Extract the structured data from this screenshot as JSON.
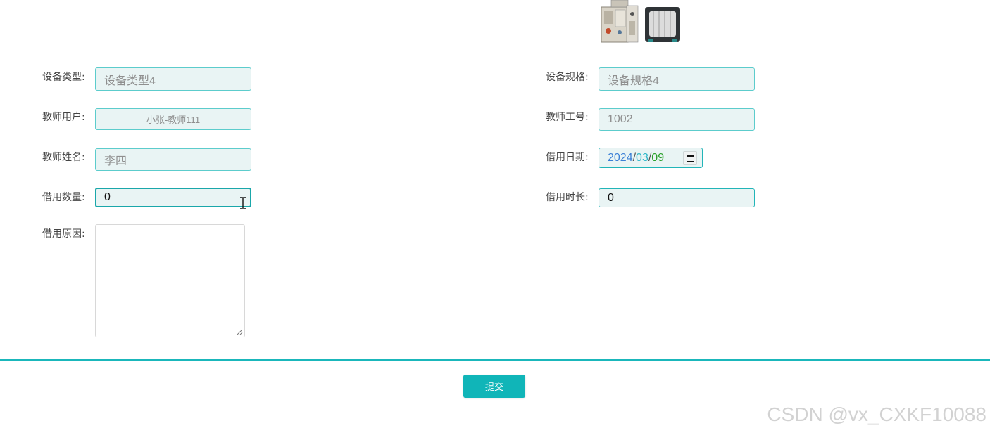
{
  "form": {
    "device_type": {
      "label": "设备类型:",
      "value": "设备类型4"
    },
    "device_spec": {
      "label": "设备规格:",
      "value": "设备规格4"
    },
    "teacher_user": {
      "label": "教师用户:",
      "value": "小张-教师111"
    },
    "teacher_id": {
      "label": "教师工号:",
      "value": "1002"
    },
    "teacher_name": {
      "label": "教师姓名:",
      "value": "李四"
    },
    "borrow_date": {
      "label": "借用日期:",
      "year": "2024",
      "month": "03",
      "day": "09",
      "separator": "/"
    },
    "borrow_qty": {
      "label": "借用数量:",
      "value": "0"
    },
    "borrow_duration": {
      "label": "借用时长:",
      "value": "0"
    },
    "borrow_reason": {
      "label": "借用原因:",
      "value": ""
    }
  },
  "submit_label": "提交",
  "watermark": "CSDN @vx_CXKF10088",
  "colors": {
    "accent": "#10b5b8",
    "field_bg": "#e9f4f4",
    "field_border": "#5ccccc"
  }
}
